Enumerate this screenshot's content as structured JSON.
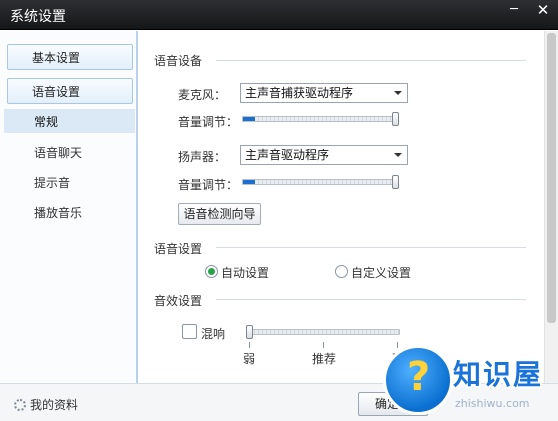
{
  "window": {
    "title": "系统设置",
    "min_glyph": "─",
    "close_glyph": "✕"
  },
  "sidebar": {
    "basic_settings": "基本设置",
    "voice_settings": "语音设置",
    "items": [
      {
        "label": "常规",
        "active": true
      },
      {
        "label": "语音聊天",
        "active": false
      },
      {
        "label": "提示音",
        "active": false
      },
      {
        "label": "播放音乐",
        "active": false
      }
    ]
  },
  "voice_device": {
    "section_title": "语音设备",
    "mic_label": "麦克风：",
    "mic_value": "主声音捕获驱动程序",
    "mic_volume_label": "音量调节：",
    "mic_volume": 1.0,
    "speaker_label": "扬声器：",
    "speaker_value": "主声音驱动程序",
    "speaker_volume_label": "音量调节：",
    "speaker_volume": 1.0,
    "wizard_button": "语音检测向导"
  },
  "voice_setting": {
    "section_title": "语音设置",
    "auto_label": "自动设置",
    "custom_label": "自定义设置",
    "selected": "auto"
  },
  "sound_effect": {
    "section_title": "音效设置",
    "reverb_label": "混响",
    "reverb_checked": false,
    "reverb_level": 0,
    "tick_weak": "弱",
    "tick_recommended": "推荐",
    "tick_strong": "强"
  },
  "footer": {
    "profile_label": "我的资料",
    "ok_label": "确定"
  },
  "watermark": {
    "brand": "知识屋",
    "domain": "zhishiwu.com",
    "glyph": "?"
  },
  "colors": {
    "accent": "#1a6fd0",
    "titlebar": "#1f2023",
    "radio_on": "#2aa24a"
  },
  "icons": {
    "profile": "gear-icon",
    "dropdown": "chevron-down-icon"
  }
}
